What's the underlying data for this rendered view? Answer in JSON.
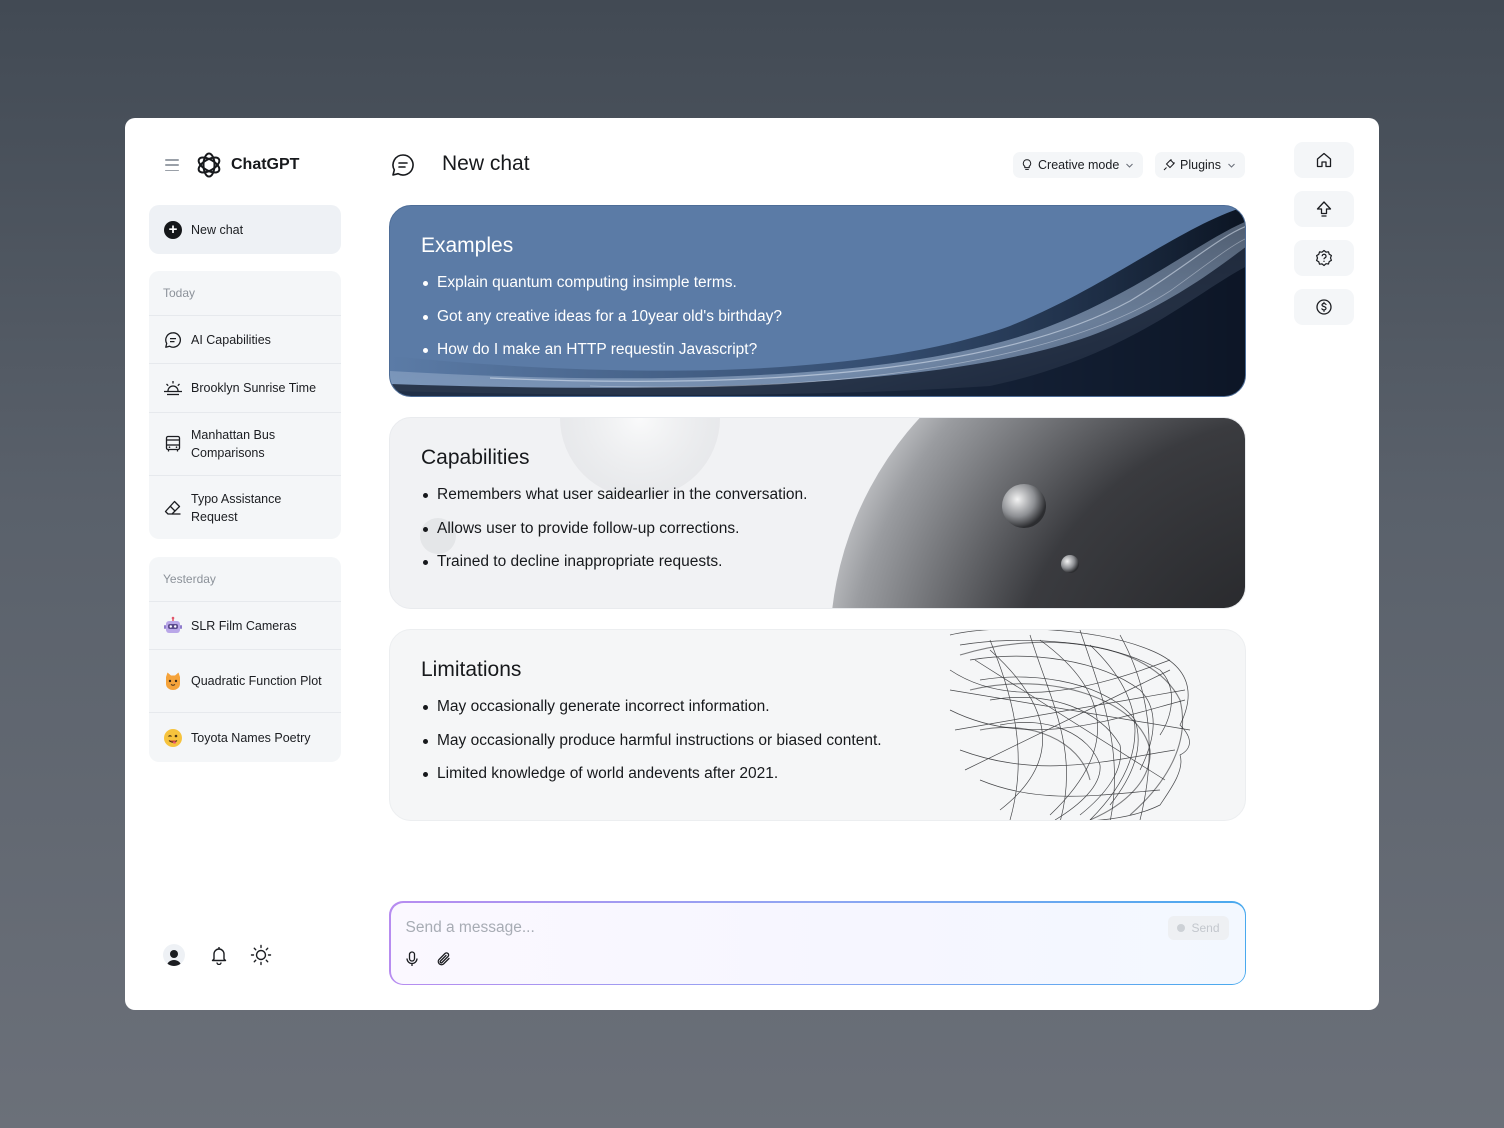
{
  "app": {
    "name": "ChatGPT"
  },
  "sidebar": {
    "new_chat_label": "New chat",
    "groups": [
      {
        "title": "Today",
        "items": [
          {
            "label": "AI Capabilities",
            "icon": "chat-bubble-icon"
          },
          {
            "label": "Brooklyn Sunrise Time",
            "icon": "sunrise-icon"
          },
          {
            "label": "Manhattan Bus Comparisons",
            "icon": "bus-icon"
          },
          {
            "label": "Typo Assistance Request",
            "icon": "eraser-icon"
          }
        ]
      },
      {
        "title": "Yesterday",
        "items": [
          {
            "label": "SLR Film Cameras",
            "icon": "robot-emoji-icon"
          },
          {
            "label": "Quadratic Function Plot",
            "icon": "cat-emoji-icon"
          },
          {
            "label": "Toyota Names Poetry",
            "icon": "winking-face-emoji-icon"
          }
        ]
      }
    ],
    "bottom_icons": [
      "avatar",
      "bell-icon",
      "sun-icon"
    ]
  },
  "header": {
    "title": "New chat",
    "mode_label": "Creative mode",
    "plugins_label": "Plugins"
  },
  "cards": {
    "examples": {
      "title": "Examples",
      "items": [
        "Explain quantum computing insimple terms.",
        "Got any creative ideas for a 10year old's birthday?",
        "How do I make an HTTP requestin Javascript?"
      ]
    },
    "capabilities": {
      "title": "Capabilities",
      "items": [
        "Remembers what user saidearlier in the conversation.",
        "Allows user to provide follow-up corrections.",
        "Trained to decline inappropriate requests."
      ]
    },
    "limitations": {
      "title": "Limitations",
      "items": [
        "May occasionally generate incorrect information.",
        "May occasionally produce harmful instructions or biased content.",
        "Limited knowledge of world andevents after 2021."
      ]
    }
  },
  "composer": {
    "placeholder": "Send a message...",
    "send_label": "Send"
  },
  "right_rail": [
    "home-icon",
    "upload-arrow-icon",
    "help-icon",
    "dollar-icon"
  ],
  "colors": {
    "examples_card": "#5b7ba6",
    "composer_gradient_start": "#b78cf0",
    "composer_gradient_end": "#49a9ee"
  }
}
